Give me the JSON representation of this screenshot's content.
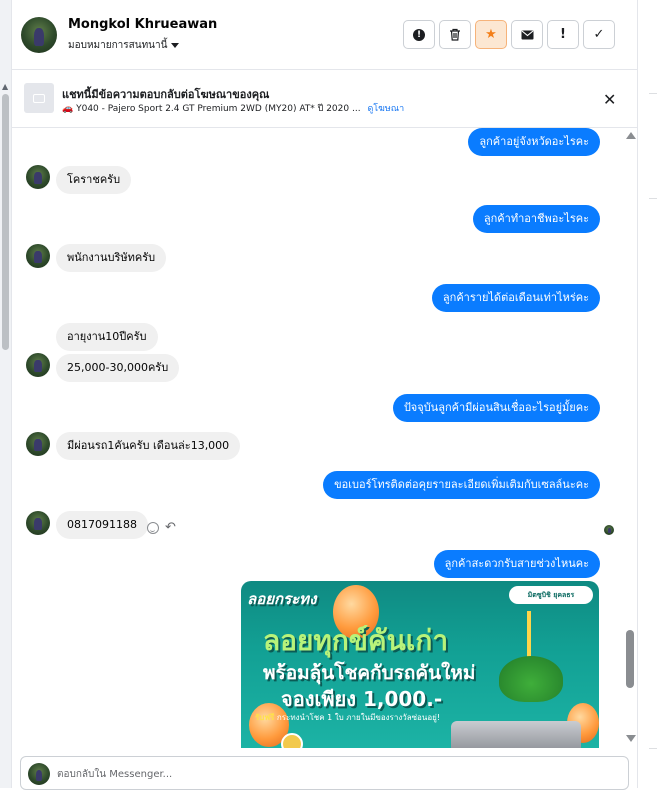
{
  "header": {
    "contact_name": "Mongkol Khrueawan",
    "assign_label": "มอบหมายการสนทนานี้",
    "actions": [
      {
        "name": "spam-button",
        "glyph": "!"
      },
      {
        "name": "delete-button",
        "glyph": "🗑"
      },
      {
        "name": "star-button",
        "glyph": "★"
      },
      {
        "name": "mark-unread-button",
        "glyph": "✉"
      },
      {
        "name": "follow-up-button",
        "glyph": "!"
      },
      {
        "name": "mark-done-button",
        "glyph": "✓"
      }
    ]
  },
  "ad_banner": {
    "title": "แชทนี้มีข้อความตอบกลับต่อโฆษณาของคุณ",
    "subtitle": "Y040 - Pajero Sport 2.4 GT Premium 2WD (MY20) AT* ปี 2020 ...",
    "link_label": "ดูโฆษณา",
    "close_glyph": "✕"
  },
  "messages": [
    {
      "dir": "out",
      "text": "ลูกค้าอยู่จังหวัดอะไรคะ"
    },
    {
      "dir": "in",
      "text": "โคราชครับ"
    },
    {
      "dir": "out",
      "text": "ลูกค้าทำอาชีพอะไรคะ"
    },
    {
      "dir": "in",
      "text": "พนักงานบริษัทครับ"
    },
    {
      "dir": "out",
      "text": "ลูกค้ารายได้ต่อเดือนเท่าไหร่คะ"
    },
    {
      "dir": "in",
      "text": "อายุงาน10ปีครับ"
    },
    {
      "dir": "in",
      "text": "25,000-30,000ครับ"
    },
    {
      "dir": "out",
      "text": "ปัจจุบันลูกค้ามีผ่อนสินเชื่ออะไรอยู่มั้ยคะ"
    },
    {
      "dir": "in",
      "text": "มีผ่อนรถ1คันครับ เดือนล่ะ13,000"
    },
    {
      "dir": "out",
      "text": "ขอเบอร์โทรติดต่อคุยรายละเอียดเพิ่มเติมกับเซลล์นะคะ"
    },
    {
      "dir": "in",
      "text": "0817091188"
    },
    {
      "dir": "out",
      "text": "ลูกค้าสะดวกรับสายช่วงไหนคะ"
    }
  ],
  "promo_image": {
    "kicker": "ลอยกระทง",
    "line1": "ลอยทุกข์คันเก่า",
    "line2": "พร้อมลุ้นโชคกับรถคันใหม่",
    "line3": "จองเพียง 1,000.-",
    "promo_highlight": "รับฟรี",
    "promo_rest": " กระทงนำโชค 1 ใบ ภายในมีของรางวัลซ่อนอยู่!",
    "logo_text": "มิตซูบิชิ ยุคลธร"
  },
  "composer": {
    "placeholder": "ตอบกลับใน Messenger..."
  },
  "colors": {
    "outgoing_bubble": "#0a7cff",
    "incoming_bubble": "#f0f0f0",
    "star_accent": "#f37f19",
    "link": "#1877f2"
  }
}
